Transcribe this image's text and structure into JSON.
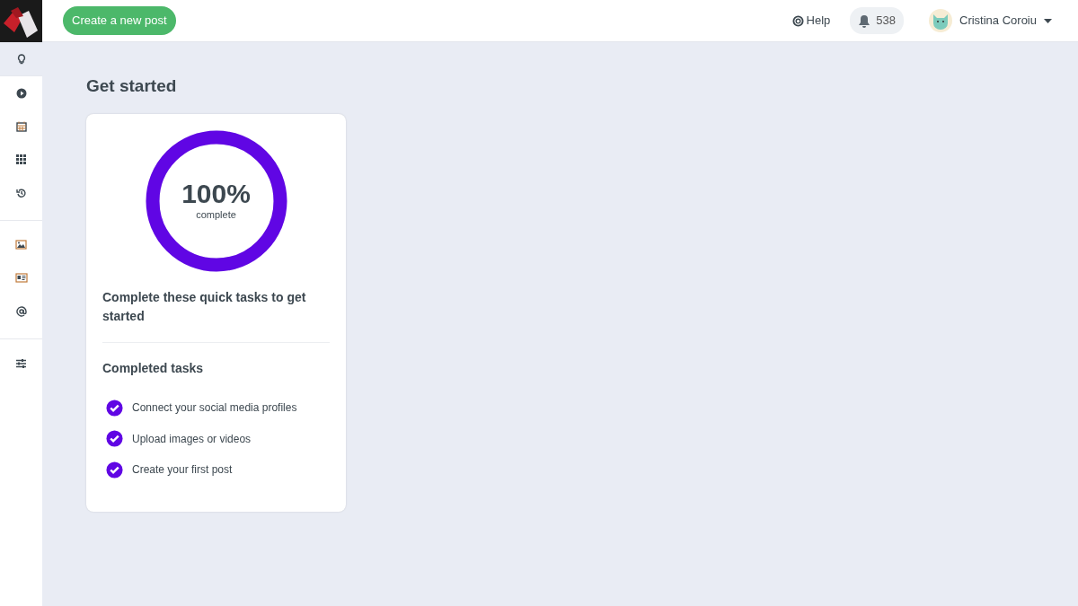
{
  "topbar": {
    "create_button": "Create a new post",
    "help": "Help",
    "notifications": "538",
    "user_name": "Cristina Coroiu"
  },
  "sidebar": {
    "groups": [
      {
        "items": [
          {
            "kind": "lightbulb",
            "selected": true
          }
        ]
      },
      {
        "items": [
          {
            "kind": "play",
            "selected": false
          },
          {
            "kind": "calendar",
            "selected": false
          },
          {
            "kind": "grid",
            "selected": false
          },
          {
            "kind": "history",
            "selected": false
          }
        ]
      },
      {
        "items": [
          {
            "kind": "image",
            "selected": false
          },
          {
            "kind": "card",
            "selected": false
          },
          {
            "kind": "at",
            "selected": false
          }
        ]
      },
      {
        "items": [
          {
            "kind": "sliders",
            "selected": false
          }
        ]
      }
    ]
  },
  "page_title": "Get started",
  "progress": {
    "level": 1.0,
    "percent": "100%",
    "caption": "complete"
  },
  "intro": "Complete these quick tasks to get started",
  "tasks_heading": "Completed tasks",
  "tasks": [
    {
      "label": "Connect your social media profiles",
      "checked": true
    },
    {
      "label": "Upload images or videos",
      "checked": true
    },
    {
      "label": "Create your first post",
      "checked": true
    }
  ]
}
